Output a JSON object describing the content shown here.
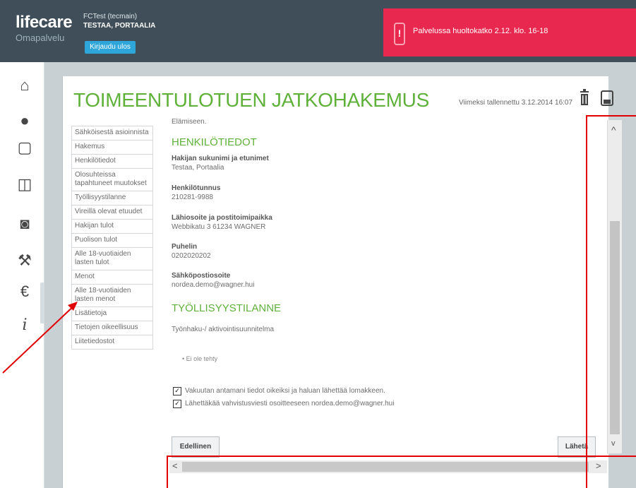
{
  "header": {
    "logo": "lifecare",
    "logo_sub": "Omapalvelu",
    "user_name": "FCTest (tecmain)",
    "user_org": "TESTAA, PORTAALIA",
    "logout_label": "Kirjaudu ulos",
    "alert_text": "Palvelussa huoltokatko 2.12. klo. 16-18",
    "alert_icon": "!"
  },
  "colors": {
    "header_bg": "#3f4e58",
    "alert_bg": "#e8284f",
    "accent_green": "#5fb13a",
    "logout_blue": "#2fa6d9",
    "annotation_red": "#e00000"
  },
  "left_nav": [
    {
      "icon": "home-icon",
      "glyph": "⌂"
    },
    {
      "icon": "user-icon",
      "glyph": "●"
    },
    {
      "icon": "document-icon",
      "glyph": "▢"
    },
    {
      "icon": "documents-icon",
      "glyph": "◫"
    },
    {
      "icon": "inbox-icon",
      "glyph": "◙"
    },
    {
      "icon": "gavel-icon",
      "glyph": "⚒"
    },
    {
      "icon": "euro-icon",
      "glyph": "€"
    },
    {
      "icon": "info-icon",
      "glyph": "i"
    }
  ],
  "page": {
    "title": "TOIMEENTULOTUEN JATKOHAKEMUS",
    "last_saved": "Viimeksi tallennettu 3.12.2014 16:07"
  },
  "sidenav": [
    "Sähköisestä asioinnista",
    "Hakemus",
    "Henkilötiedot",
    "Olosuhteissa tapahtuneet muutokset",
    "Työllisyystilanne",
    "Vireillä olevat etuudet",
    "Hakijan tulot",
    "Puolison tulot",
    "Alle 18-vuotiaiden lasten tulot",
    "Menot",
    "Alle 18-vuotiaiden lasten menot",
    "Lisätietoja",
    "Tietojen oikeellisuus",
    "Liitetiedostot"
  ],
  "content": {
    "top_text": "Elämiseen.",
    "section_personal": "HENKILÖTIEDOT",
    "fields": [
      {
        "label": "Hakijan sukunimi ja etunimet",
        "value": "Testaa, Portaalia"
      },
      {
        "label": "Henkilötunnus",
        "value": "210281-9988"
      },
      {
        "label": "Lähiosoite ja postitoimipaikka",
        "value": "Webbikatu 3 61234 WAGNER"
      },
      {
        "label": "Puhelin",
        "value": "0202020202"
      },
      {
        "label": "Sähköpostiosoite",
        "value": "nordea.demo@wagner.hui"
      }
    ],
    "section_employment": "TYÖLLISYYSTILANNE",
    "employment_label": "Työnhaku-/ aktivointisuunnitelma",
    "employment_bullet": "• Ei ole tehty",
    "confirm_1": "Vakuutan antamani tiedot oikeiksi ja haluan lähettää lomakkeen.",
    "confirm_2": "Lähettäkää vahvistusviesti osoitteeseen nordea.demo@wagner.hui",
    "check_glyph": "✓"
  },
  "buttons": {
    "prev": "Edellinen",
    "send": "Lähetä"
  },
  "scroll": {
    "up": "^",
    "down": "v",
    "left": "<",
    "right": ">"
  }
}
